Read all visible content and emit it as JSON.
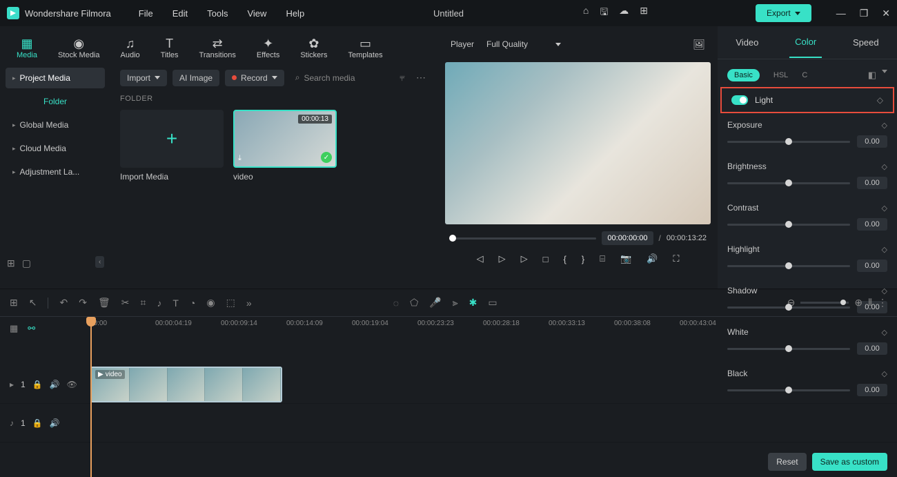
{
  "app": {
    "name": "Wondershare Filmora",
    "document": "Untitled"
  },
  "menu": [
    "File",
    "Edit",
    "Tools",
    "View",
    "Help"
  ],
  "export": "Export",
  "modules": [
    {
      "icon": "▦",
      "label": "Media",
      "active": true
    },
    {
      "icon": "◉",
      "label": "Stock Media"
    },
    {
      "icon": "♫",
      "label": "Audio"
    },
    {
      "icon": "T",
      "label": "Titles"
    },
    {
      "icon": "⇄",
      "label": "Transitions"
    },
    {
      "icon": "✦",
      "label": "Effects"
    },
    {
      "icon": "✿",
      "label": "Stickers"
    },
    {
      "icon": "▭",
      "label": "Templates"
    }
  ],
  "sidebar": {
    "project": "Project Media",
    "folder": "Folder",
    "items": [
      "Global Media",
      "Cloud Media",
      "Adjustment La..."
    ]
  },
  "media_toolbar": {
    "import": "Import",
    "ai_image": "AI Image",
    "record": "Record",
    "search_placeholder": "Search media"
  },
  "folder_label": "FOLDER",
  "media_items": {
    "import_label": "Import Media",
    "video": {
      "name": "video",
      "duration": "00:00:13"
    }
  },
  "preview": {
    "player": "Player",
    "quality": "Full Quality",
    "current": "00:00:00:00",
    "total": "00:00:13:22"
  },
  "right_panel": {
    "tabs": [
      "Video",
      "Color",
      "Speed"
    ],
    "active_tab": "Color",
    "subtabs": [
      "Basic",
      "HSL",
      "C"
    ],
    "active_subtab": "Basic",
    "light_section": "Light",
    "params": [
      {
        "name": "Exposure",
        "value": "0.00"
      },
      {
        "name": "Brightness",
        "value": "0.00"
      },
      {
        "name": "Contrast",
        "value": "0.00"
      },
      {
        "name": "Highlight",
        "value": "0.00"
      },
      {
        "name": "Shadow",
        "value": "0.00"
      },
      {
        "name": "White",
        "value": "0.00"
      },
      {
        "name": "Black",
        "value": "0.00"
      }
    ],
    "reset": "Reset",
    "save": "Save as custom"
  },
  "timeline": {
    "ruler": [
      "00:00",
      "00:00:04:19",
      "00:00:09:14",
      "00:00:14:09",
      "00:00:19:04",
      "00:00:23:23",
      "00:00:28:18",
      "00:00:33:13",
      "00:00:38:08",
      "00:00:43:04"
    ],
    "clip_label": "video",
    "video_track": "1",
    "audio_track": "1"
  }
}
